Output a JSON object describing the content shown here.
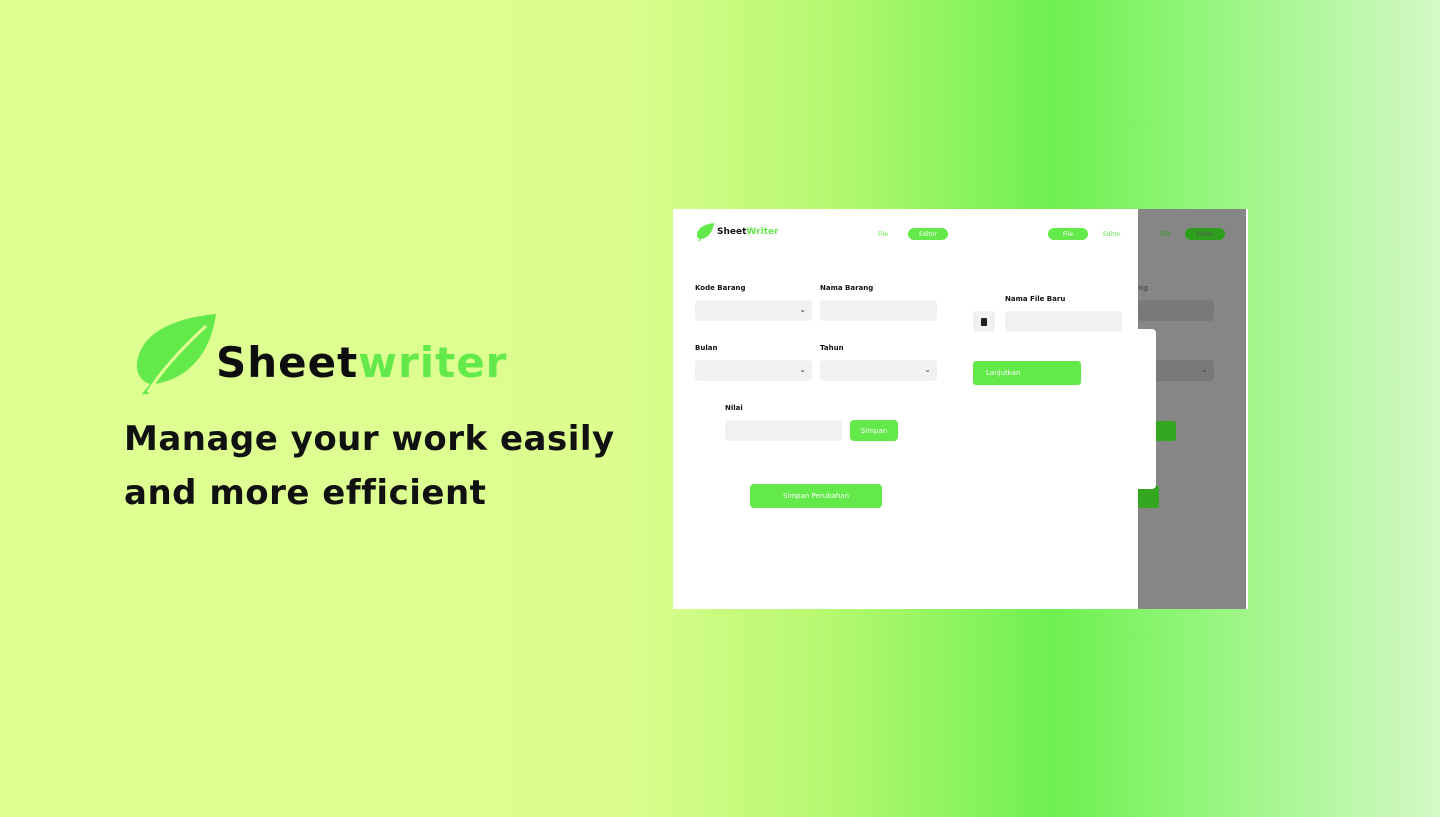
{
  "hero": {
    "brand_part1": "Sheet",
    "brand_part2": "writer",
    "tagline_line1": "Manage your work easily",
    "tagline_line2": "and more efficient"
  },
  "app": {
    "logo_part1": "Sheet",
    "logo_part2": "Writer",
    "nav_file": "File",
    "nav_editor": "Editor",
    "form": {
      "kode_barang_label": "Kode Barang",
      "nama_barang_label": "Nama Barang",
      "bulan_label": "Bulan",
      "tahun_label": "Tahun",
      "nilai_label": "Nilai",
      "simpan_button": "Simpan",
      "simpan_perubahan_button": "Simpan Perubahan"
    },
    "file_panel": {
      "nav_file": "File",
      "nav_editor": "Editor",
      "nama_file_baru_label": "Nama File Baru",
      "lanjutkan_button": "Lanjutkan"
    },
    "dimmed": {
      "nav_file": "File",
      "nav_editor": "Editor",
      "label_fragment": "ng"
    }
  },
  "colors": {
    "accent": "#63ea4a",
    "overlay": "#868686",
    "text_dark": "#111111"
  }
}
